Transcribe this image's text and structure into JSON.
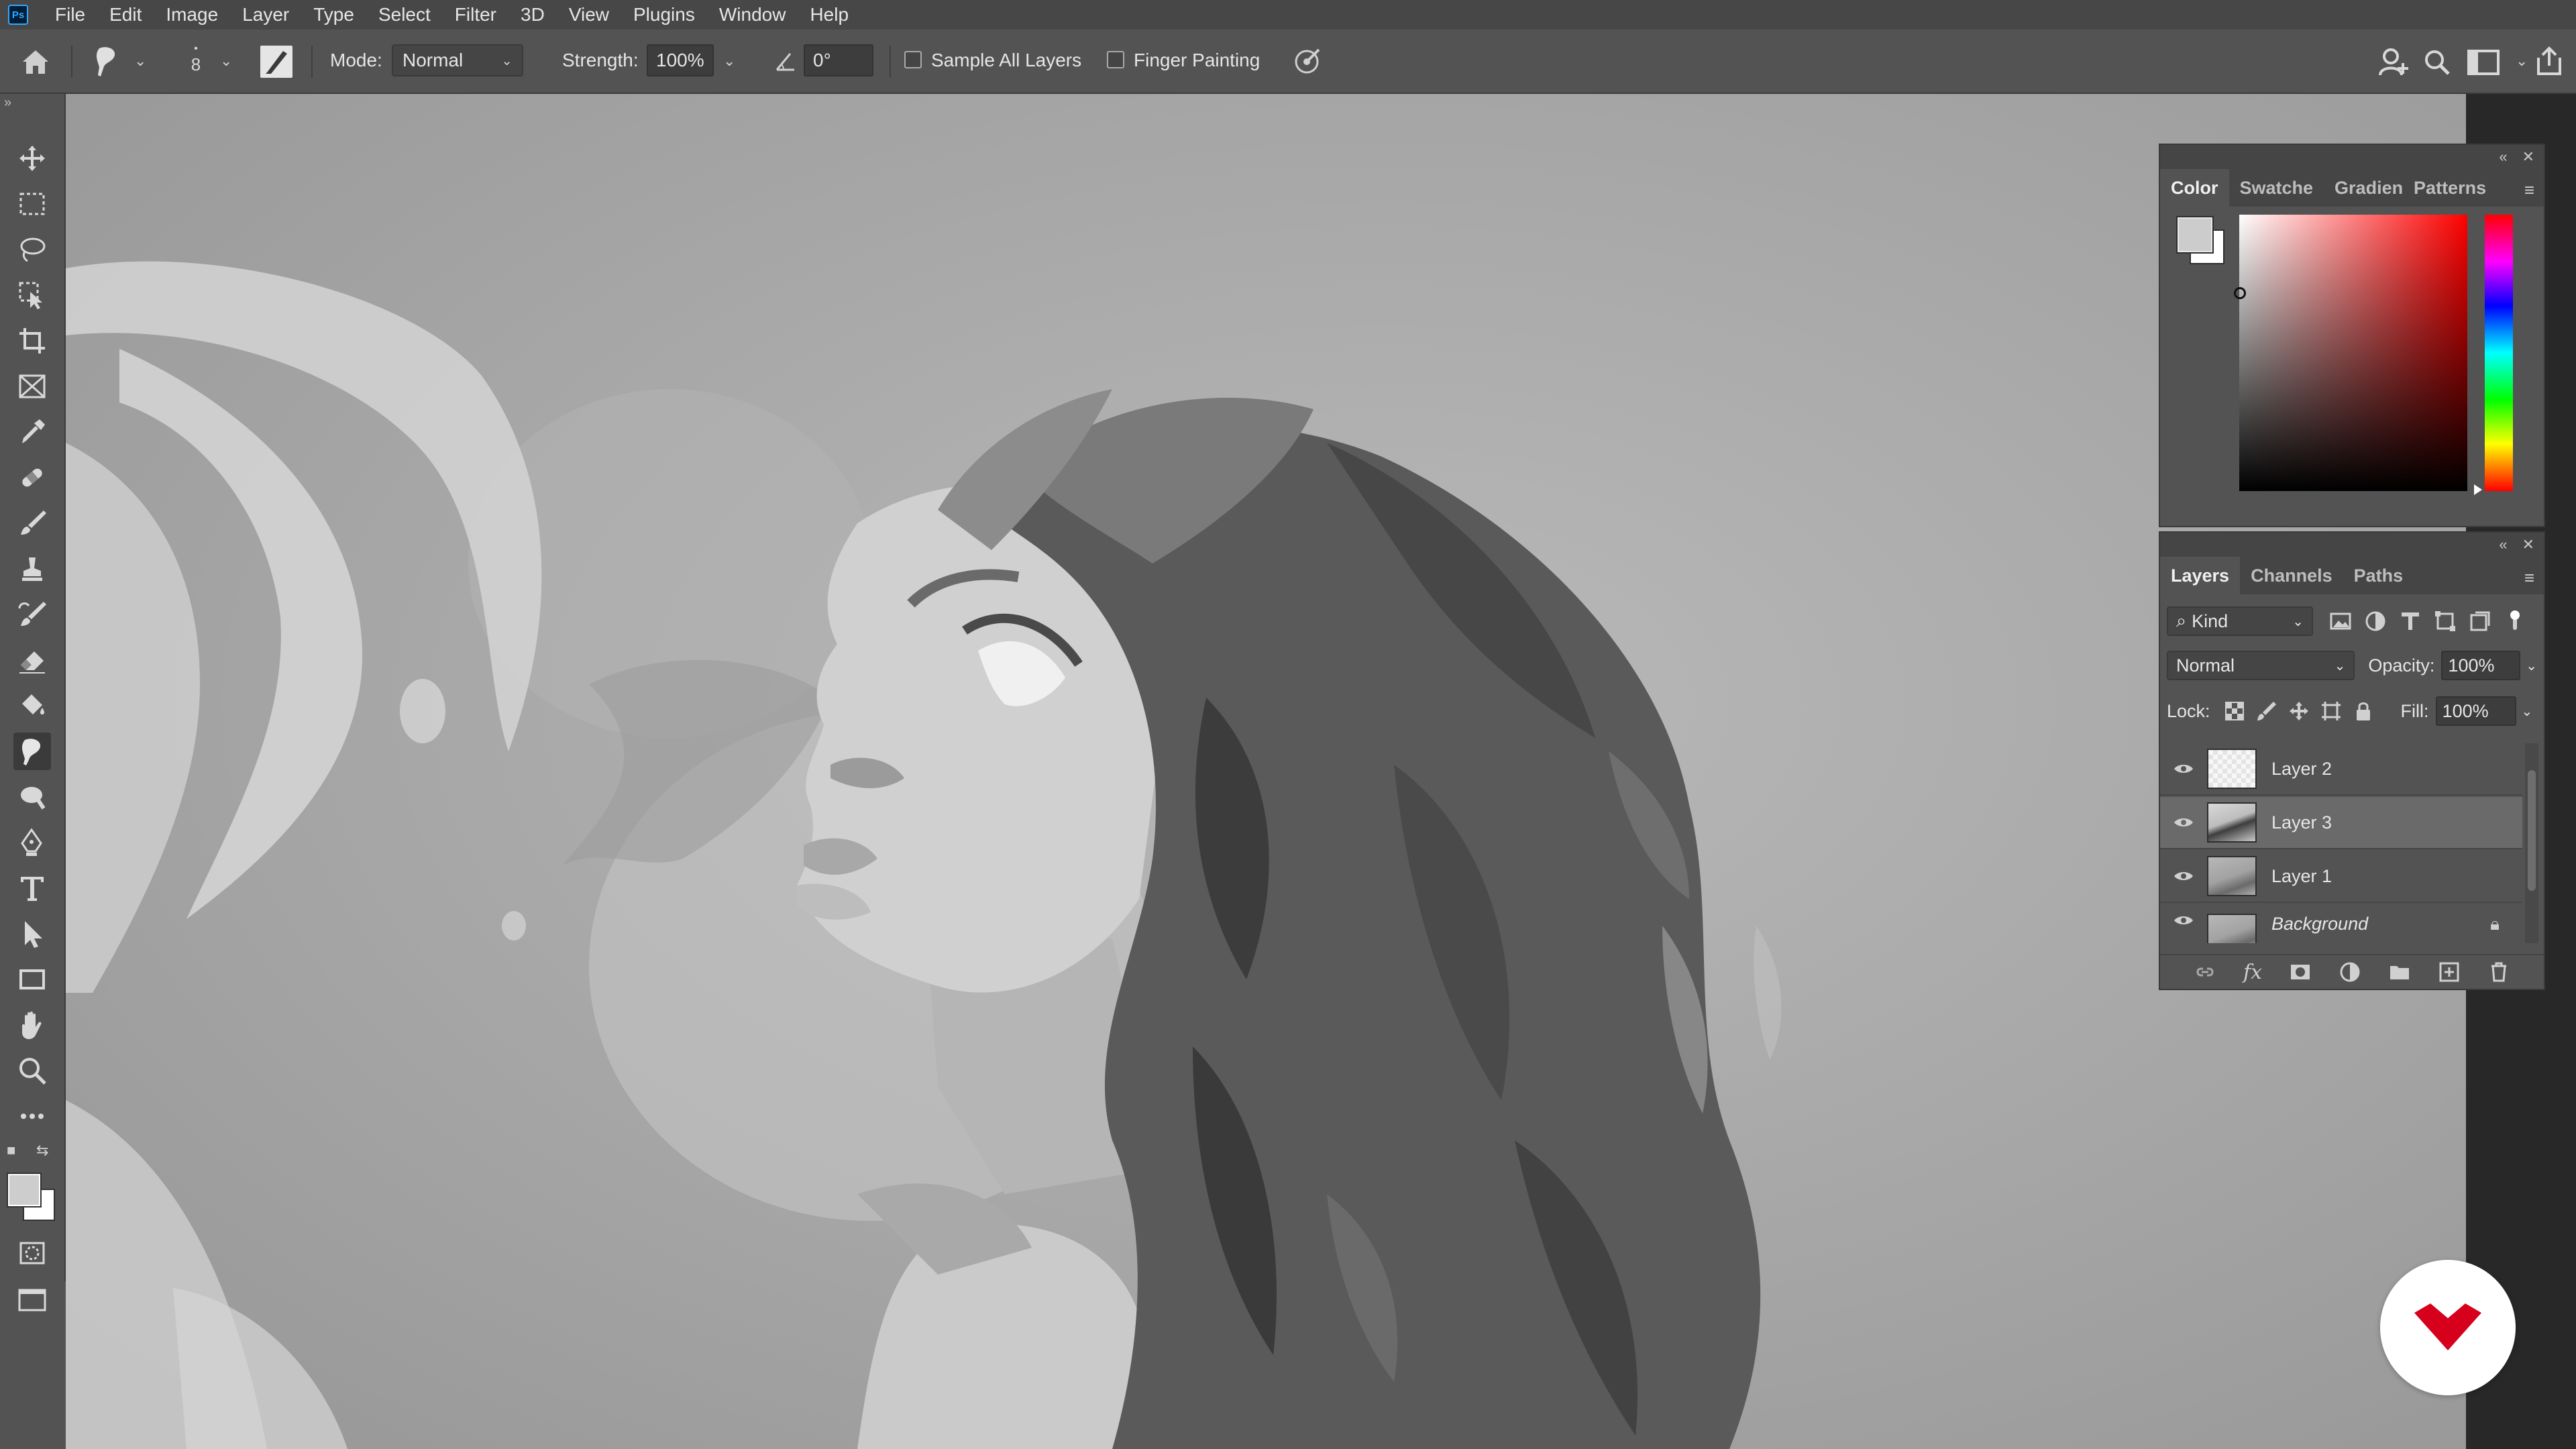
{
  "menubar": {
    "logo": "Ps",
    "items": [
      "File",
      "Edit",
      "Image",
      "Layer",
      "Type",
      "Select",
      "Filter",
      "3D",
      "View",
      "Plugins",
      "Window",
      "Help"
    ]
  },
  "options": {
    "brush_size": "8",
    "mode_label": "Mode:",
    "mode_value": "Normal",
    "strength_label": "Strength:",
    "strength_value": "100%",
    "angle_value": "0°",
    "sample_all_layers": "Sample All Layers",
    "finger_painting": "Finger Painting"
  },
  "toolbar": {
    "active_tool": "smudge-tool",
    "foreground_color": "#cdcdcd",
    "background_color": "#ffffff"
  },
  "color_panel": {
    "tabs": [
      "Color",
      "Swatche",
      "Gradient",
      "Patterns"
    ],
    "active_tab": "Color",
    "hue_color": "#ff0000"
  },
  "layers_panel": {
    "tabs": [
      "Layers",
      "Channels",
      "Paths"
    ],
    "active_tab": "Layers",
    "filter_kind": "Kind",
    "blend_mode": "Normal",
    "opacity_label": "Opacity:",
    "opacity_value": "100%",
    "lock_label": "Lock:",
    "fill_label": "Fill:",
    "fill_value": "100%",
    "layers": [
      {
        "name": "Layer 2",
        "visible": true,
        "selected": false
      },
      {
        "name": "Layer 3",
        "visible": true,
        "selected": true
      },
      {
        "name": "Layer 1",
        "visible": true,
        "selected": false
      },
      {
        "name": "Background",
        "visible": true,
        "selected": false,
        "locked": true
      }
    ]
  },
  "watermark": {
    "color": "#d6001c"
  }
}
